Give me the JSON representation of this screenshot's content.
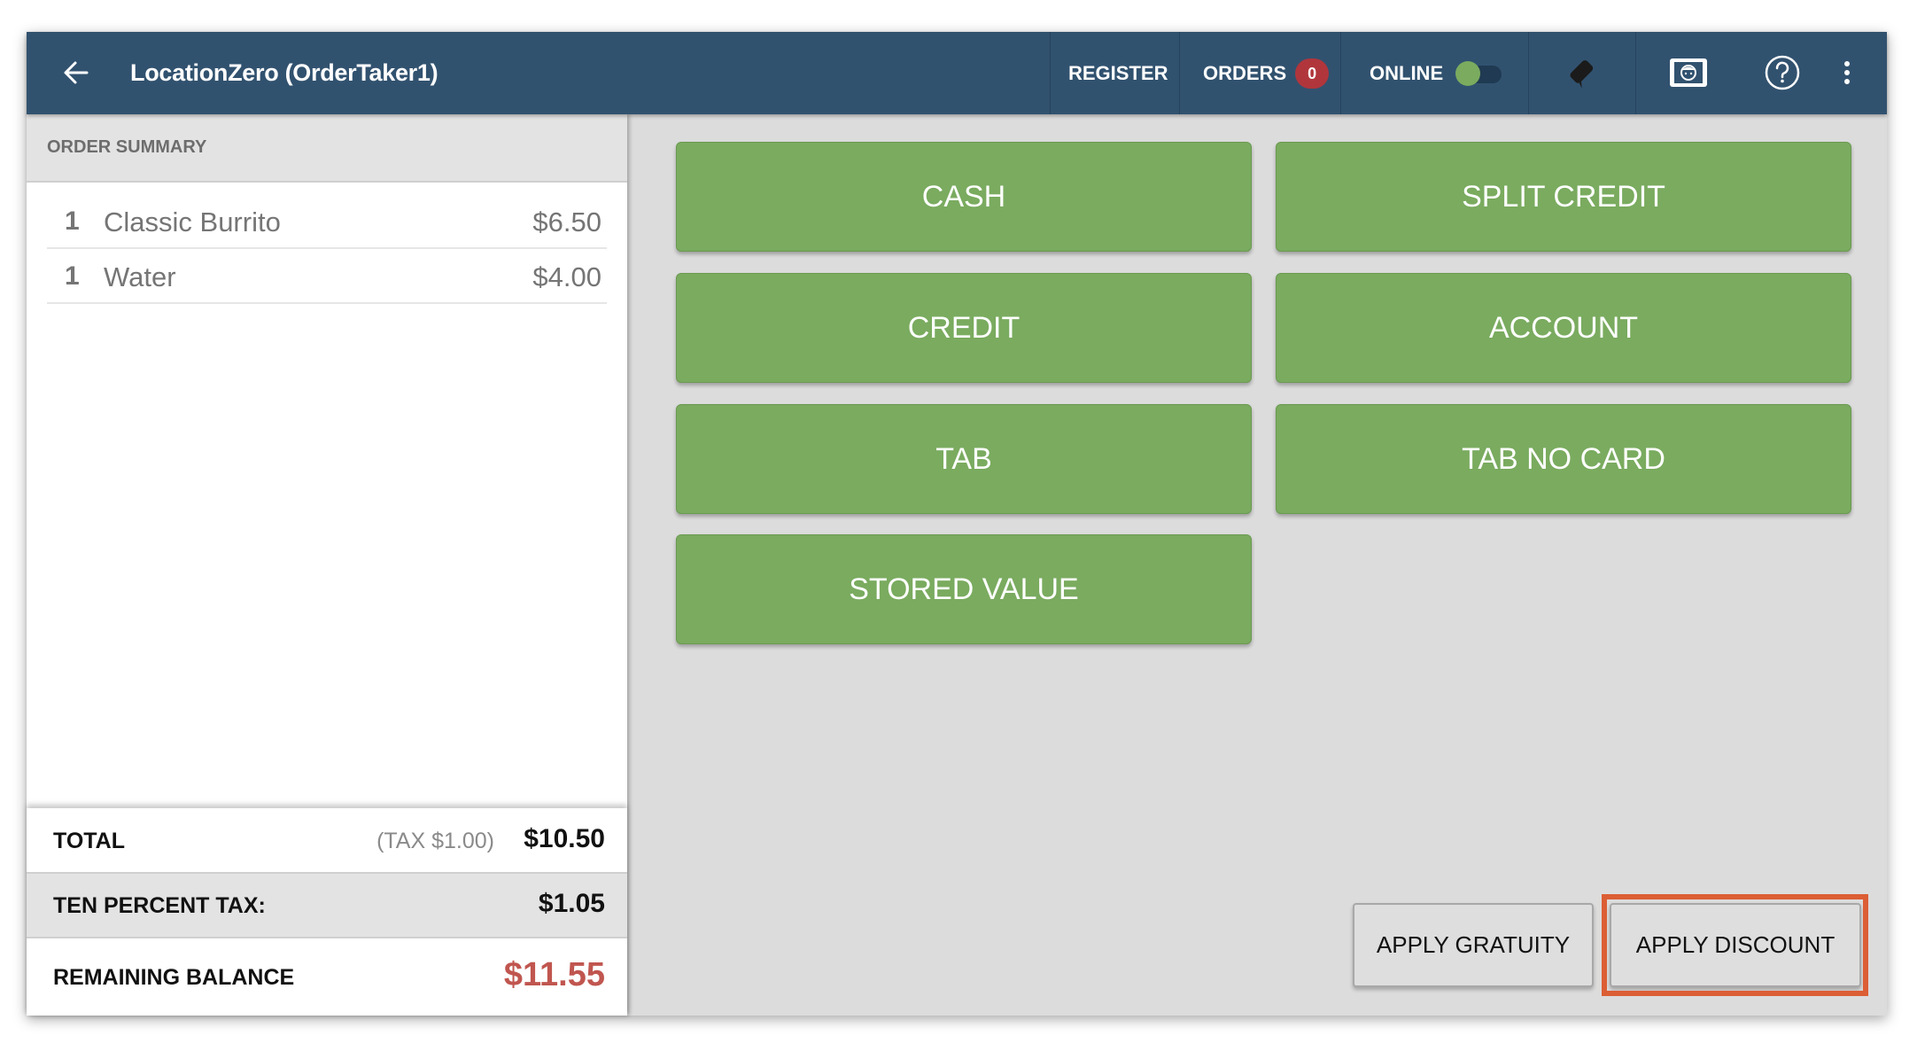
{
  "header": {
    "title": "LocationZero (OrderTaker1)",
    "register_label": "REGISTER",
    "orders_label": "ORDERS",
    "orders_count": "0",
    "online_label": "ONLINE",
    "online_enabled": true,
    "icons": [
      "back-arrow-icon",
      "card-reader-icon",
      "customer-display-icon",
      "help-icon",
      "more-vertical-icon"
    ]
  },
  "order_summary": {
    "title": "ORDER SUMMARY",
    "items": [
      {
        "qty": "1",
        "name": "Classic Burrito",
        "price": "$6.50"
      },
      {
        "qty": "1",
        "name": "Water",
        "price": "$4.00"
      }
    ],
    "total_label": "TOTAL",
    "total_tax_note": "(TAX $1.00)",
    "total_value": "$10.50",
    "tax_label": "TEN PERCENT TAX:",
    "tax_value": "$1.05",
    "remaining_label": "REMAINING BALANCE",
    "remaining_value": "$11.55"
  },
  "payment_methods": [
    {
      "label": "CASH"
    },
    {
      "label": "SPLIT CREDIT"
    },
    {
      "label": "CREDIT"
    },
    {
      "label": "ACCOUNT"
    },
    {
      "label": "TAB"
    },
    {
      "label": "TAB NO CARD"
    },
    {
      "label": "STORED VALUE"
    }
  ],
  "actions": {
    "apply_gratuity": "APPLY GRATUITY",
    "apply_discount": "APPLY DISCOUNT"
  },
  "colors": {
    "header_bg": "#31526f",
    "payment_green": "#7aab5f",
    "badge_red": "#b0363c",
    "balance_red": "#c0564f",
    "highlight_orange": "#dc5e35"
  }
}
